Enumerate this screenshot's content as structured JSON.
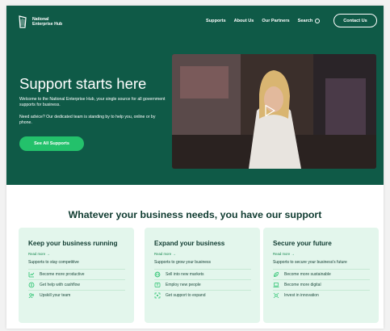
{
  "header": {
    "logo_text": "National\nEnterprise Hub",
    "nav": [
      "Supports",
      "About Us",
      "Our Partners"
    ],
    "search_label": "Search",
    "contact_label": "Contact Us"
  },
  "hero": {
    "title": "Support starts here",
    "intro": "Welcome to the National Enterprise Hub, your single source for all government supports for business.",
    "advice": "Need advice? Our dedicated team is standing by to help you, online or by phone.",
    "cta_label": "See All Supports"
  },
  "section": {
    "title": "Whatever your business needs, you have our support",
    "cards": [
      {
        "title": "Keep your business running",
        "read_more": "Read more →",
        "subtitle": "Supports to stay competitive",
        "items": [
          {
            "label": "Become more productive",
            "icon": "chart-icon"
          },
          {
            "label": "Get help with cashflow",
            "icon": "cashflow-icon"
          },
          {
            "label": "Upskill your team",
            "icon": "team-icon"
          }
        ]
      },
      {
        "title": "Expand your business",
        "read_more": "Read more →",
        "subtitle": "Supports to grow your business",
        "items": [
          {
            "label": "Sell into new markets",
            "icon": "globe-icon"
          },
          {
            "label": "Employ new people",
            "icon": "people-icon"
          },
          {
            "label": "Get support to expand",
            "icon": "expand-icon"
          }
        ]
      },
      {
        "title": "Secure your future",
        "read_more": "Read more →",
        "subtitle": "Supports to secure your business's future",
        "items": [
          {
            "label": "Become more sustainable",
            "icon": "leaf-icon"
          },
          {
            "label": "Become more digital",
            "icon": "laptop-icon"
          },
          {
            "label": "Invest in innovation",
            "icon": "innovation-icon"
          }
        ]
      }
    ]
  },
  "colors": {
    "hero_bg": "#0f5a47",
    "accent": "#23c16b",
    "card_bg": "#e3f6ec",
    "heading": "#0f3b30"
  }
}
